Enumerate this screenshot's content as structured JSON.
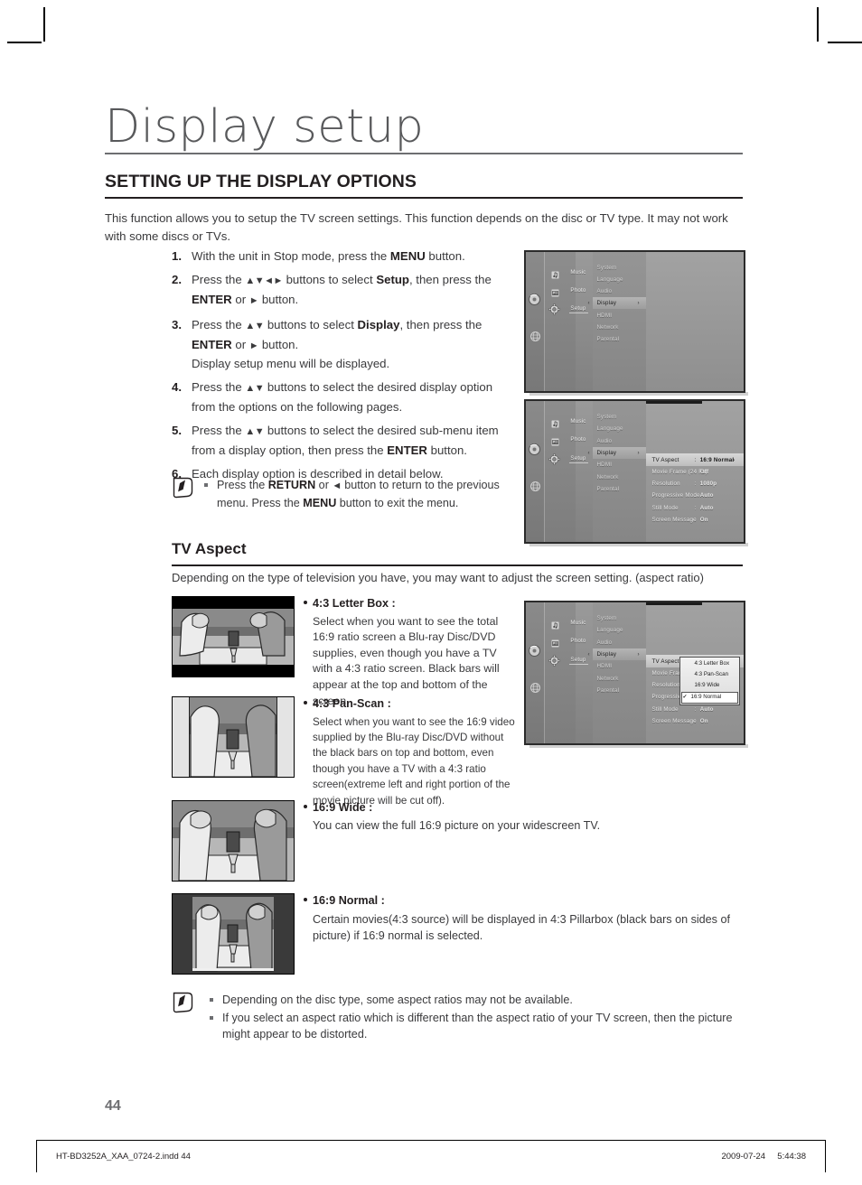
{
  "document": {
    "title": "Display setup",
    "section_heading": "SETTING UP THE DISPLAY OPTIONS",
    "intro": "This function allows you to setup the TV screen settings. This function depends on the disc or TV type. It may not work with some discs or TVs.",
    "page_number": "44"
  },
  "steps": [
    {
      "num": "1.",
      "html": "With the unit in Stop mode, press the <b>MENU</b> button."
    },
    {
      "num": "2.",
      "html": "Press the <span class=\"arr\">▲▼◄►</span> buttons to select <b>Setup</b>, then press the <b>ENTER</b> or <span class=\"arr\">►</span> button."
    },
    {
      "num": "3.",
      "html": "Press the <span class=\"arr\">▲▼</span> buttons to select <b>Display</b>, then press the <b>ENTER</b> or <span class=\"arr\">►</span> button.<br>Display setup menu will be displayed."
    },
    {
      "num": "4.",
      "html": "Press the <span class=\"arr\">▲▼</span> buttons to select the desired display option from the options on the following pages."
    },
    {
      "num": "5.",
      "html": "Press the <span class=\"arr\">▲▼</span> buttons to select the desired sub-menu item from a display option, then press the <b>ENTER</b> button."
    },
    {
      "num": "6.",
      "html": "Each display option is described in detail below."
    }
  ],
  "note_top": {
    "icon": "pencil-note-icon",
    "items": [
      "Press the <b>RETURN</b> or <span class=\"arr\">◄</span> button to return to the previous menu. Press the <b>MENU</b> button to exit the menu."
    ]
  },
  "tv_aspect": {
    "heading": "TV Aspect",
    "subtitle": "Depending on the type of television you have, you may want to adjust the screen setting. (aspect ratio)",
    "options": [
      {
        "head": "4:3 Letter Box :",
        "body": "Select when you want to see the total 16:9 ratio screen a Blu-ray Disc/DVD supplies, even though you have a TV with a 4:3 ratio screen. Black bars will appear at the top and bottom of the screen.",
        "thumb": "letterbox-thumbnail"
      },
      {
        "head": "4:3 Pan-Scan :",
        "body": "Select when you want to see the 16:9 video supplied by the Blu-ray Disc/DVD without the black bars on top and bottom, even though you have a TV with a 4:3 ratio screen(extreme left and right portion of the movie picture will be cut off).",
        "thumb": "panscan-thumbnail"
      },
      {
        "head": "16:9 Wide :",
        "body": "You can view the full 16:9 picture on your widescreen TV.",
        "thumb": "wide-thumbnail"
      },
      {
        "head": "16:9 Normal :",
        "body": "Certain movies(4:3 source) will be displayed in 4:3 Pillarbox (black bars on sides of picture) if 16:9 normal is selected.",
        "thumb": "normal-thumbnail"
      }
    ]
  },
  "note_bottom": {
    "icon": "pencil-note-icon",
    "items": [
      "Depending on the disc type, some aspect ratios may not be available.",
      "If you select an aspect ratio which is different than the aspect ratio of your TV screen, then the picture might appear to be distorted."
    ]
  },
  "osd": {
    "rail_icons": [
      "disc-icon",
      "globe-icon"
    ],
    "categories": [
      {
        "label": "Music",
        "icon": "music-note-icon"
      },
      {
        "label": "Photo",
        "icon": "photo-icon"
      },
      {
        "label": "Setup",
        "icon": "gear-icon"
      }
    ],
    "menu": [
      "System",
      "Language",
      "Audio",
      "Display",
      "HDMI",
      "Network",
      "Parental"
    ],
    "selected_menu": "Display",
    "display_settings": [
      {
        "label": "TV Aspect",
        "sep": ":",
        "value": "16:9 Normal"
      },
      {
        "label": "Movie Frame (24 Fs)",
        "sep": ":",
        "value": "Off"
      },
      {
        "label": "Resolution",
        "sep": ":",
        "value": "1080p"
      },
      {
        "label": "Progressive Mode",
        "sep": ":",
        "value": "Auto"
      },
      {
        "label": "Still Mode",
        "sep": ":",
        "value": "Auto"
      },
      {
        "label": "Screen Message",
        "sep": ":",
        "value": "On"
      }
    ],
    "dropdown": {
      "options": [
        "4:3 Letter Box",
        "4:3 Pan-Scan",
        "16:9 Wide",
        "16:9 Normal"
      ],
      "checked": "16:9 Normal",
      "check_glyph": "✓"
    }
  },
  "footer": {
    "left": "HT-BD3252A_XAA_0724-2.indd   44",
    "date": "2009-07-24",
    "time": "5:44:38"
  }
}
